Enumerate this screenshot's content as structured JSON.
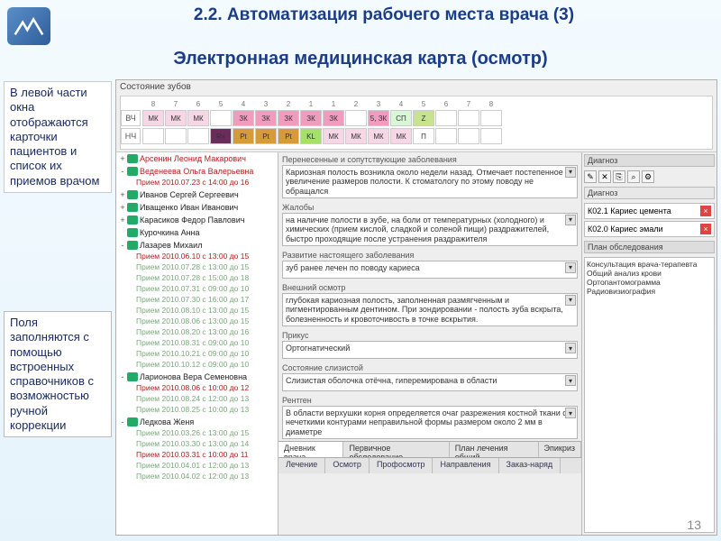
{
  "slide": {
    "title": "2.2. Автоматизация рабочего места врача (3)",
    "subtitle": "Электронная медицинская карта (осмотр)",
    "page_number": "13"
  },
  "sidenotes": {
    "note1": "В левой части окна отображаются карточки пациентов и список их приемов врачом",
    "note2": "Поля заполняются с помощью встроенных справочников с возможностью ручной коррекции"
  },
  "teeth_panel": {
    "title": "Состояние зубов",
    "rows": {
      "upper_label": "ВЧ",
      "lower_label": "НЧ",
      "numbers": [
        "8",
        "7",
        "6",
        "5",
        "4",
        "3",
        "2",
        "1",
        "1",
        "2",
        "3",
        "4",
        "5",
        "6",
        "7",
        "8"
      ],
      "upper": [
        {
          "t": "МК",
          "c": "#f7d7e6"
        },
        {
          "t": "МК",
          "c": "#f7d7e6"
        },
        {
          "t": "МК",
          "c": "#f7d7e6"
        },
        {
          "t": "",
          "c": "#ffffff"
        },
        {
          "t": "ЗК",
          "c": "#f19bbf"
        },
        {
          "t": "ЗК",
          "c": "#f19bbf"
        },
        {
          "t": "ЗК",
          "c": "#f19bbf"
        },
        {
          "t": "ЗК",
          "c": "#f19bbf"
        },
        {
          "t": "ЗК",
          "c": "#f19bbf"
        },
        {
          "t": "",
          "c": "#ffffff"
        },
        {
          "t": "5, ЗК",
          "c": "#f19bbf"
        },
        {
          "t": "СП",
          "c": "#d7f7d7"
        },
        {
          "t": "Z",
          "c": "#c8e38f"
        },
        {
          "t": "",
          "c": "#fff"
        },
        {
          "t": "",
          "c": "#fff"
        },
        {
          "t": "",
          "c": "#fff"
        }
      ],
      "lower": [
        {
          "t": "",
          "c": "#fff"
        },
        {
          "t": "",
          "c": "#fff"
        },
        {
          "t": "",
          "c": "#fff"
        },
        {
          "t": "Rx",
          "c": "#6b2b5b"
        },
        {
          "t": "Pt",
          "c": "#d69a3a"
        },
        {
          "t": "Pt",
          "c": "#d69a3a"
        },
        {
          "t": "Pt",
          "c": "#d69a3a"
        },
        {
          "t": "KL",
          "c": "#a6e06a"
        },
        {
          "t": "МК",
          "c": "#f7d7e6"
        },
        {
          "t": "МК",
          "c": "#f7d7e6"
        },
        {
          "t": "МК",
          "c": "#f7d7e6"
        },
        {
          "t": "МК",
          "c": "#f7d7e6"
        },
        {
          "t": "П",
          "c": "#fff"
        },
        {
          "t": "",
          "c": "#fff"
        },
        {
          "t": "",
          "c": "#fff"
        },
        {
          "t": "",
          "c": "#fff"
        }
      ]
    }
  },
  "patients": [
    {
      "exp": "+",
      "name": "Арсенин Леонид Макарович",
      "cls": "red"
    },
    {
      "exp": "-",
      "name": "Веденеева Ольга Валерьевна",
      "cls": "red",
      "appts": [
        {
          "t": "Прием 2010.07.23 c 14:00 до 16",
          "cls": "red"
        }
      ]
    },
    {
      "exp": "+",
      "name": "Иванов Сергей Сергеевич",
      "cls": "black"
    },
    {
      "exp": "+",
      "name": "Иващенко Иван Иванович",
      "cls": "black"
    },
    {
      "exp": "+",
      "name": "Карасиков Федор Павлович",
      "cls": "black"
    },
    {
      "exp": "",
      "name": "Курочкина Анна",
      "cls": "black"
    },
    {
      "exp": "-",
      "name": "Лазарев Михаил",
      "cls": "black",
      "appts": [
        {
          "t": "Прием 2010.06.10 c 13:00 до 15",
          "cls": "red"
        },
        {
          "t": "Прием 2010.07.28 c 13:00 до 15",
          "cls": "gray"
        },
        {
          "t": "Прием 2010.07.28 c 15:00 до 18",
          "cls": "gray"
        },
        {
          "t": "Прием 2010.07.31 c 09:00 до 10",
          "cls": "gray"
        },
        {
          "t": "Прием 2010.07.30 c 16:00 до 17",
          "cls": "gray"
        },
        {
          "t": "Прием 2010.08.10 c 13:00 до 15",
          "cls": "gray"
        },
        {
          "t": "Прием 2010.08.06 c 13:00 до 15",
          "cls": "gray"
        },
        {
          "t": "Прием 2010.08.20 c 13:00 до 16",
          "cls": "gray"
        },
        {
          "t": "Прием 2010.08.31 c 09:00 до 10",
          "cls": "gray"
        },
        {
          "t": "Прием 2010.10.21 c 09:00 до 10",
          "cls": "gray"
        },
        {
          "t": "Прием 2010.10.12 c 09:00 до 10",
          "cls": "gray"
        }
      ]
    },
    {
      "exp": "-",
      "name": "Ларионова Вера Семеновна",
      "cls": "black",
      "appts": [
        {
          "t": "Прием 2010.08.06 c 10:00 до 12",
          "cls": "red"
        },
        {
          "t": "Прием 2010.08.24 c 12:00 до 13",
          "cls": "gray"
        },
        {
          "t": "Прием 2010.08.25 c 10:00 до 13",
          "cls": "gray"
        }
      ]
    },
    {
      "exp": "-",
      "name": "Ледкова Женя",
      "cls": "black",
      "appts": [
        {
          "t": "Прием 2010.03.26 c 13:00 до 15",
          "cls": "gray"
        },
        {
          "t": "Прием 2010.03.30 c 13:00 до 14",
          "cls": "gray"
        },
        {
          "t": "Прием 2010.03.31 c 10:00 до 11",
          "cls": "red"
        },
        {
          "t": "Прием 2010.04.01 c 12:00 до 13",
          "cls": "gray"
        },
        {
          "t": "Прием 2010.04.02 c 12:00 до 13",
          "cls": "gray"
        }
      ]
    }
  ],
  "exam": {
    "f1_label": "Перенесенные и сопутствующие заболевания",
    "f1_text": "Кариозная полость возникла около недели назад. Отмечает постепенное увеличение размеров полости. К стоматологу по этому поводу не обращался",
    "f2_label": "Жалобы",
    "f2_text": "на наличие полости в зубе, на боли от температурных (холодного) и химических (прием кислой, сладкой и соленой пищи) раздражителей, быстро проходящие после устранения раздражителя",
    "f3_label": "Развитие настоящего заболевания",
    "f3_text": "зуб ранее лечен по поводу кариеса",
    "f4_label": "Внешний осмотр",
    "f4_text": "глубокая кариозная полость, заполненная размягченным и пигментированным дентином. При зондировании - полость зуба вскрыта, болезненность и кровоточивость в точке вскрытия.",
    "f5_label": "Прикус",
    "f5_text": "Ортогнатический",
    "f6_label": "Состояние слизистой",
    "f6_text": "Слизистая оболочка отёчна, гиперемирована в области",
    "f7_label": "Рентген",
    "f7_text": "В области верхушки корня определяется очаг разрежения костной ткани с нечеткими контурами неправильной формы размером около 2 мм в диаметре"
  },
  "diagnosis": {
    "header": "Диагноз",
    "sub": "Диагноз",
    "items": [
      {
        "code": "К02.1 Кариес цемента"
      },
      {
        "code": "К02.0 Кариес эмали"
      }
    ]
  },
  "plan": {
    "header": "План обследования",
    "items": [
      "Консультация врача-терапевта",
      "Общий анализ крови",
      "Ортопантомограмма",
      "Радиовизиография"
    ]
  },
  "tabs_center": [
    {
      "t": "Дневник врача",
      "active": true
    },
    {
      "t": "Первичное обследование"
    },
    {
      "t": "План лечения общий"
    },
    {
      "t": "Эпикриз"
    }
  ],
  "tabs_bottom": [
    {
      "t": "Лечение"
    },
    {
      "t": "Осмотр"
    },
    {
      "t": "Профосмотр"
    },
    {
      "t": "Направления"
    },
    {
      "t": "Заказ-наряд"
    }
  ]
}
